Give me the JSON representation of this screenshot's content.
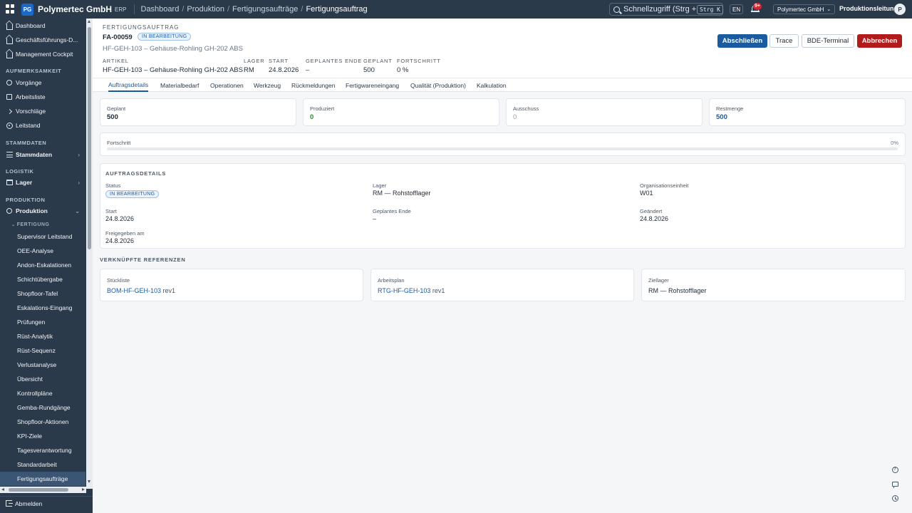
{
  "topbar": {
    "brand_initials": "PG",
    "brand": "Polymertec GmbH",
    "product": "ERP",
    "breadcrumb": [
      "Dashboard",
      "Produktion",
      "Fertigungsaufträge",
      "Fertigungsauftrag"
    ],
    "search_placeholder": "Schnellzugriff (Strg + K...",
    "search_shortcut": "Strg K",
    "language": "EN",
    "notifications_badge": "9+",
    "company": "Polymertec GmbH",
    "role": "Produktionsleitung",
    "avatar_initial": "P"
  },
  "sidebar": {
    "items": {
      "dashboard": "Dashboard",
      "gf_dashboard": "Geschäftsführungs-D...",
      "management": "Management Cockpit",
      "vorgaenge": "Vorgänge",
      "arbeitsliste": "Arbeitsliste",
      "vorschlaege": "Vorschläge",
      "leitstand": "Leitstand",
      "stammdaten": "Stammdaten",
      "lager": "Lager",
      "produktion": "Produktion"
    },
    "sections": {
      "aufmerksamkeit": "AUFMERKSAMKEIT",
      "stammdaten": "STAMMDATEN",
      "logistik": "LOGISTIK",
      "produktion": "PRODUKTION",
      "fertigung": "FERTIGUNG"
    },
    "fertigung_items": [
      "Supervisor Leitstand",
      "OEE-Analyse",
      "Andon-Eskalationen",
      "Schichtübergabe",
      "Shopfloor-Tafel",
      "Eskalations-Eingang",
      "Prüfungen",
      "Rüst-Analytik",
      "Rüst-Sequenz",
      "Verlustanalyse",
      "Übersicht",
      "Kontrollpläne",
      "Gemba-Rundgänge",
      "Shopfloor-Aktionen",
      "KPI-Ziele",
      "Tagesverantwortung",
      "Standardarbeit",
      "Fertigungsaufträge"
    ],
    "logout": "Abmelden"
  },
  "header": {
    "eyebrow": "FERTIGUNGSAUFTRAG",
    "order_no": "FA-00059",
    "status": "IN BEARBEITUNG",
    "subtitle": "HF-GEH-103 – Gehäuse-Rohling GH-202 ABS",
    "meta": {
      "artikel_label": "ARTIKEL",
      "artikel_value": "HF-GEH-103 – Gehäuse-Rohling GH-202 ABS",
      "lager_label": "LAGER",
      "lager_value": "RM",
      "start_label": "START",
      "start_value": "24.8.2026",
      "ende_label": "GEPLANTES ENDE",
      "ende_value": "–",
      "geplant_label": "GEPLANT",
      "geplant_value": "500",
      "fortschritt_label": "FORTSCHRITT",
      "fortschritt_value": "0 %"
    },
    "buttons": {
      "abschliessen": "Abschließen",
      "trace": "Trace",
      "bde": "BDE-Terminal",
      "abbrechen": "Abbrechen"
    }
  },
  "tabs": [
    "Auftragsdetails",
    "Materialbedarf",
    "Operationen",
    "Werkzeug",
    "Rückmeldungen",
    "Fertigwareneingang",
    "Qualität (Produktion)",
    "Kalkulation"
  ],
  "kpis": {
    "geplant": {
      "label": "Geplant",
      "value": "500"
    },
    "produziert": {
      "label": "Produziert",
      "value": "0"
    },
    "ausschuss": {
      "label": "Ausschuss",
      "value": "0"
    },
    "restmenge": {
      "label": "Restmenge",
      "value": "500"
    }
  },
  "progress": {
    "label": "Fortschritt",
    "pct_text": "0%",
    "fraction": 0
  },
  "details": {
    "title": "AUFTRAGSDETAILS",
    "status_label": "Status",
    "status_value": "IN BEARBEITUNG",
    "lager_label": "Lager",
    "lager_value": "RM — Rohstofflager",
    "org_label": "Organisationseinheit",
    "org_value": "W01",
    "start_label": "Start",
    "start_value": "24.8.2026",
    "ende_label": "Geplantes Ende",
    "ende_value": "–",
    "geaendert_label": "Geändert",
    "geaendert_value": "24.8.2026",
    "freigegeben_label": "Freigegeben am",
    "freigegeben_value": "24.8.2026"
  },
  "references": {
    "title": "VERKNÜPFTE REFERENZEN",
    "stueckliste_label": "Stückliste",
    "stueckliste_link": "BOM-HF-GEH-103",
    "stueckliste_rev": "rev1",
    "arbeitsplan_label": "Arbeitsplan",
    "arbeitsplan_link": "RTG-HF-GEH-103",
    "arbeitsplan_rev": "rev1",
    "ziellager_label": "Ziellager",
    "ziellager_value": "RM — Rohstofflager"
  },
  "colors": {
    "primary": "#1a5a9e",
    "danger": "#b21b1b",
    "produced": "#2e8b2e",
    "restmenge": "#1a5a9e",
    "muted_zero": "#9aa5b1",
    "sidebar_bg": "#2b3a4a"
  }
}
